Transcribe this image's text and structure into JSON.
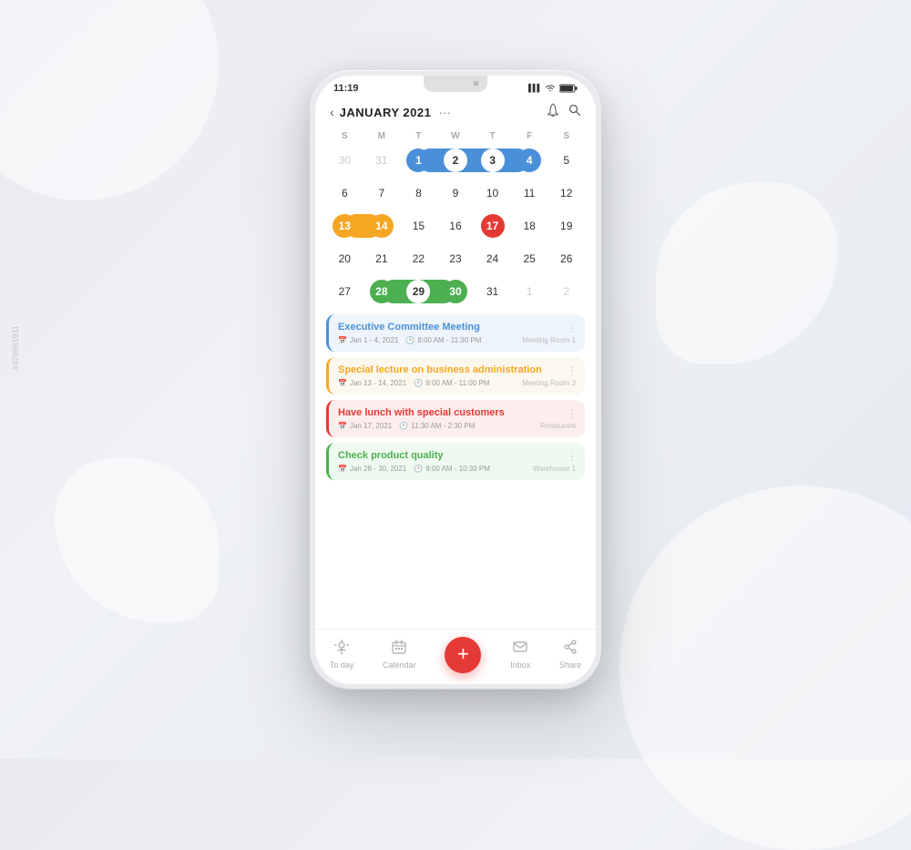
{
  "phone": {
    "status_bar": {
      "time": "11:19",
      "signal": "▌▌▌",
      "wifi": "WiFi",
      "battery": "🔋"
    },
    "header": {
      "back_label": "‹",
      "month_year": "JANUARY  2021",
      "dots_label": "...",
      "bell_label": "🔔",
      "search_label": "🔍"
    },
    "calendar": {
      "day_headers": [
        "S",
        "M",
        "T",
        "W",
        "T",
        "F",
        "S"
      ],
      "rows": [
        [
          {
            "num": "30",
            "type": "other"
          },
          {
            "num": "31",
            "type": "other"
          },
          {
            "num": "1",
            "type": "blue-start"
          },
          {
            "num": "2",
            "type": "blue-mid"
          },
          {
            "num": "3",
            "type": "blue-mid"
          },
          {
            "num": "4",
            "type": "blue-end"
          },
          {
            "num": "5",
            "type": "normal"
          }
        ],
        [
          {
            "num": "6",
            "type": "normal"
          },
          {
            "num": "7",
            "type": "normal"
          },
          {
            "num": "8",
            "type": "normal"
          },
          {
            "num": "9",
            "type": "normal"
          },
          {
            "num": "10",
            "type": "normal"
          },
          {
            "num": "11",
            "type": "normal"
          },
          {
            "num": "12",
            "type": "normal"
          }
        ],
        [
          {
            "num": "13",
            "type": "orange-start"
          },
          {
            "num": "14",
            "type": "orange-end"
          },
          {
            "num": "15",
            "type": "normal"
          },
          {
            "num": "16",
            "type": "normal"
          },
          {
            "num": "17",
            "type": "red-circle"
          },
          {
            "num": "18",
            "type": "normal"
          },
          {
            "num": "19",
            "type": "normal"
          }
        ],
        [
          {
            "num": "20",
            "type": "normal"
          },
          {
            "num": "21",
            "type": "normal"
          },
          {
            "num": "22",
            "type": "normal"
          },
          {
            "num": "23",
            "type": "normal"
          },
          {
            "num": "24",
            "type": "normal"
          },
          {
            "num": "25",
            "type": "normal"
          },
          {
            "num": "26",
            "type": "normal"
          }
        ],
        [
          {
            "num": "27",
            "type": "normal"
          },
          {
            "num": "28",
            "type": "green-start"
          },
          {
            "num": "29",
            "type": "green-mid"
          },
          {
            "num": "30",
            "type": "green-end"
          },
          {
            "num": "31",
            "type": "normal"
          },
          {
            "num": "1",
            "type": "other"
          },
          {
            "num": "2",
            "type": "other"
          }
        ]
      ]
    },
    "events": [
      {
        "id": "event-1",
        "title": "Executive Committee Meeting",
        "date": "Jan 1 - 4, 2021",
        "time": "8:00 AM - 11:30 PM",
        "location": "Meeting Room 1",
        "color": "blue"
      },
      {
        "id": "event-2",
        "title": "Special lecture on business administration",
        "date": "Jan 13 - 14, 2021",
        "time": "9:00 AM - 11:00 PM",
        "location": "Meeting Room 3",
        "color": "orange"
      },
      {
        "id": "event-3",
        "title": "Have lunch with special customers",
        "date": "Jan 17, 2021",
        "time": "11:30 AM - 2:30 PM",
        "location": "Restaurant",
        "color": "red"
      },
      {
        "id": "event-4",
        "title": "Check product quality",
        "date": "Jan 28 - 30, 2021",
        "time": "9:00 AM - 10:30 PM",
        "location": "Warehouse 1",
        "color": "green"
      }
    ],
    "bottom_nav": {
      "items": [
        {
          "label": "To day",
          "icon": "☀"
        },
        {
          "label": "Calendar",
          "icon": "▦"
        },
        {
          "label": "+",
          "type": "fab"
        },
        {
          "label": "Inbox",
          "icon": "✉"
        },
        {
          "label": "Share",
          "icon": "⇡"
        }
      ]
    }
  },
  "watermark": "#429651911"
}
